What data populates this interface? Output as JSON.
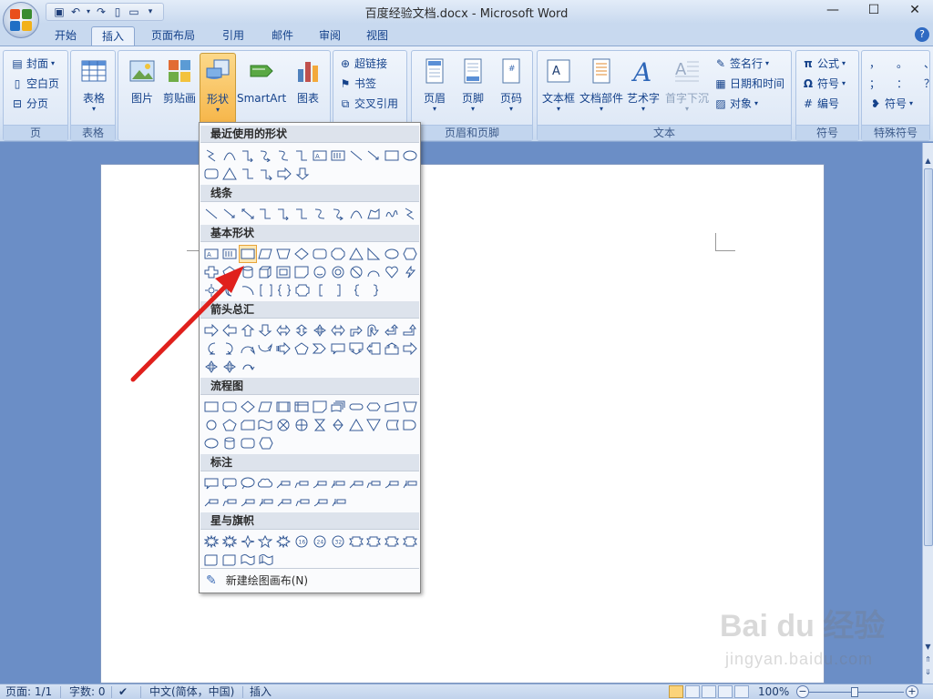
{
  "window": {
    "title": "百度经验文档.docx - Microsoft Word",
    "qat": [
      "save-icon",
      "undo-icon",
      "redo-icon",
      "new-doc-icon",
      "open-icon",
      "customize-icon"
    ],
    "controls": {
      "minimize": "—",
      "maximize": "☐",
      "close": "✕"
    }
  },
  "tabs": [
    "开始",
    "插入",
    "页面布局",
    "引用",
    "邮件",
    "审阅",
    "视图"
  ],
  "active_tab": "插入",
  "ribbon": {
    "groups": {
      "page": {
        "label": "页",
        "items": [
          "封面",
          "空白页",
          "分页"
        ]
      },
      "table": {
        "label": "表格",
        "button": "表格"
      },
      "illustrations": {
        "buttons": [
          "图片",
          "剪贴画",
          "形状",
          "SmartArt",
          "图表"
        ]
      },
      "links": {
        "items": [
          "超链接",
          "书签",
          "交叉引用"
        ]
      },
      "header_footer": {
        "label": "页眉和页脚",
        "buttons": [
          "页眉",
          "页脚",
          "页码"
        ]
      },
      "text": {
        "label": "文本",
        "buttons": [
          "文本框",
          "文档部件",
          "艺术字",
          "首字下沉"
        ],
        "items": [
          "签名行",
          "日期和时间",
          "对象"
        ]
      },
      "symbols": {
        "label": "符号",
        "items": [
          "公式",
          "符号",
          "编号"
        ]
      },
      "special": {
        "label": "特殊符号",
        "chars": [
          "，",
          "。",
          "、",
          "；",
          "：",
          "？"
        ],
        "button": "符号"
      }
    }
  },
  "shapes_menu": {
    "categories": [
      "最近使用的形状",
      "线条",
      "基本形状",
      "箭头总汇",
      "流程图",
      "标注",
      "星与旗帜"
    ],
    "new_canvas": "新建绘图画布(N)"
  },
  "status": {
    "page": "页面: 1/1",
    "words": "字数: 0",
    "language": "中文(简体，中国)",
    "mode": "插入",
    "zoom": "100%"
  },
  "watermark": {
    "main": "Bai du 经验",
    "sub": "jingyan.baidu.com"
  },
  "colors": {
    "ribbon": "#dce7f6",
    "accent": "#f6b64a",
    "canvas": "#6b8ec6",
    "annotation": "#e0201c"
  }
}
